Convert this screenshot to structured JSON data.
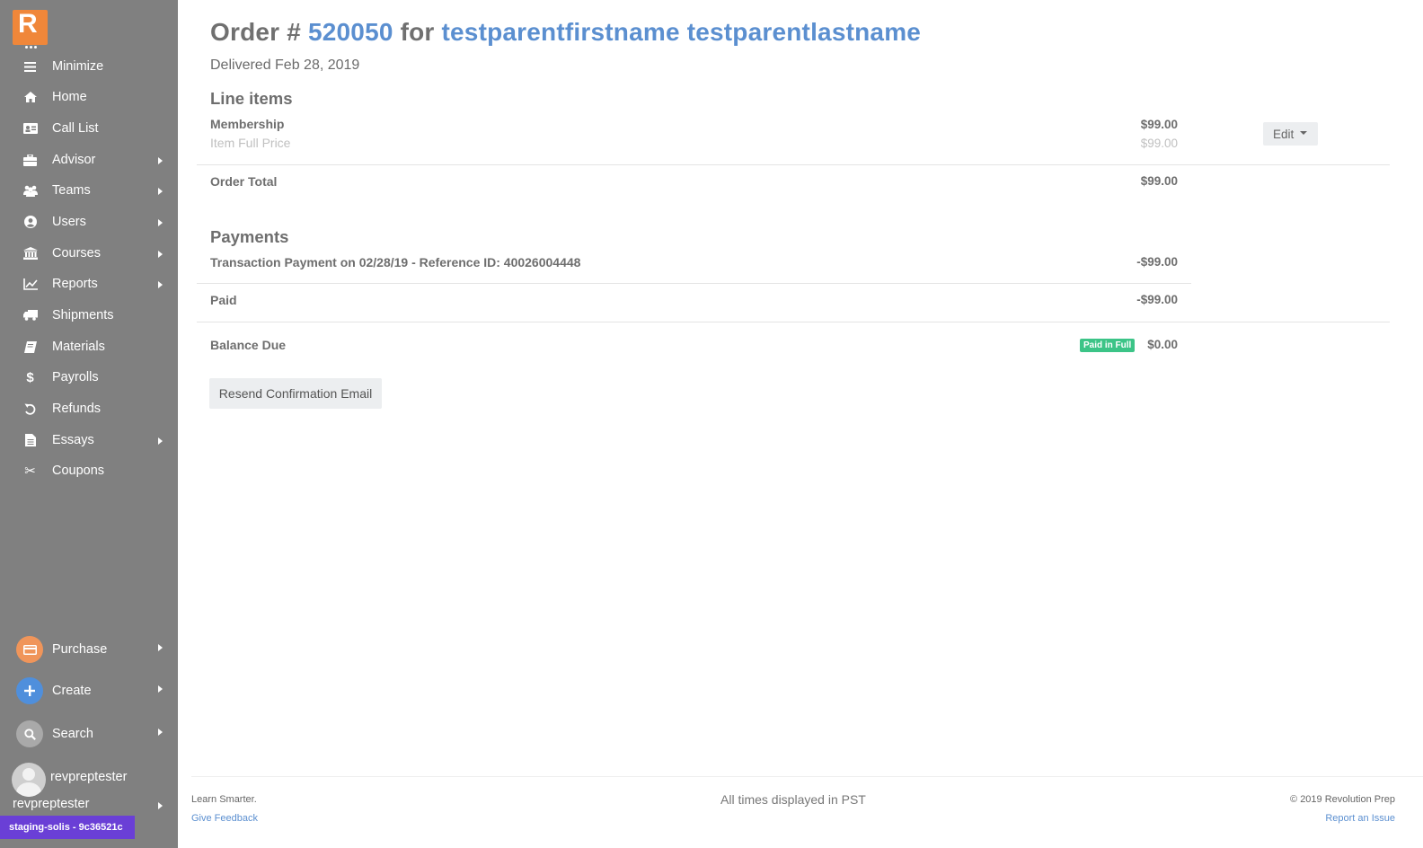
{
  "sidebar": {
    "logo_letter": "R",
    "items": [
      {
        "label": "Minimize",
        "icon": "hamburger-icon",
        "has_submenu": false
      },
      {
        "label": "Home",
        "icon": "home-icon",
        "has_submenu": false
      },
      {
        "label": "Call List",
        "icon": "id-card-icon",
        "has_submenu": false
      },
      {
        "label": "Advisor",
        "icon": "briefcase-icon",
        "has_submenu": true
      },
      {
        "label": "Teams",
        "icon": "users-group-icon",
        "has_submenu": true
      },
      {
        "label": "Users",
        "icon": "user-circle-icon",
        "has_submenu": true
      },
      {
        "label": "Courses",
        "icon": "university-icon",
        "has_submenu": true
      },
      {
        "label": "Reports",
        "icon": "line-chart-icon",
        "has_submenu": true
      },
      {
        "label": "Shipments",
        "icon": "truck-icon",
        "has_submenu": false
      },
      {
        "label": "Materials",
        "icon": "book-icon",
        "has_submenu": false
      },
      {
        "label": "Payrolls",
        "icon": "dollar-icon",
        "has_submenu": false
      },
      {
        "label": "Refunds",
        "icon": "undo-icon",
        "has_submenu": false
      },
      {
        "label": "Essays",
        "icon": "file-text-icon",
        "has_submenu": true
      },
      {
        "label": "Coupons",
        "icon": "scissors-icon",
        "has_submenu": false
      }
    ],
    "actions": [
      {
        "label": "Purchase",
        "icon": "credit-card-icon",
        "color": "#f0955a"
      },
      {
        "label": "Create",
        "icon": "plus-icon",
        "color": "#4f8fdc"
      },
      {
        "label": "Search",
        "icon": "search-icon",
        "color": "#a9a9a9"
      }
    ],
    "user_name": "revpreptester",
    "account_name": "revpreptester",
    "env_badge": "staging-solis - 9c36521c"
  },
  "order": {
    "title_prefix": "Order # ",
    "order_number": "520050",
    "title_for": " for ",
    "customer_name": "testparentfirstname testparentlastname",
    "status": "Delivered Feb 28, 2019"
  },
  "line_items": {
    "heading": "Line items",
    "item_name": "Membership",
    "item_price": "$99.00",
    "item_sub_label": "Item Full Price",
    "item_full_price": "$99.00",
    "edit_label": "Edit",
    "order_total_label": "Order Total",
    "order_total": "$99.00"
  },
  "payments": {
    "heading": "Payments",
    "transaction_label": "Transaction Payment on 02/28/19 - Reference ID: 40026004448",
    "transaction_amount": "-$99.00",
    "paid_label": "Paid",
    "paid_amount": "-$99.00",
    "balance_label": "Balance Due",
    "balance_badge": "Paid in Full",
    "balance_amount": "$0.00"
  },
  "resend_label": "Resend Confirmation Email",
  "footer": {
    "tagline": "Learn Smarter.",
    "feedback": "Give Feedback",
    "timezone": "All times displayed in PST",
    "copyright": "© 2019 Revolution Prep",
    "report_issue": "Report an Issue"
  },
  "colors": {
    "sidebar_bg": "#808080",
    "logo_orange": "#f0873a",
    "link_blue": "#5b8fd0",
    "paid_green": "#3cc487",
    "env_purple": "#6a3fd6"
  }
}
